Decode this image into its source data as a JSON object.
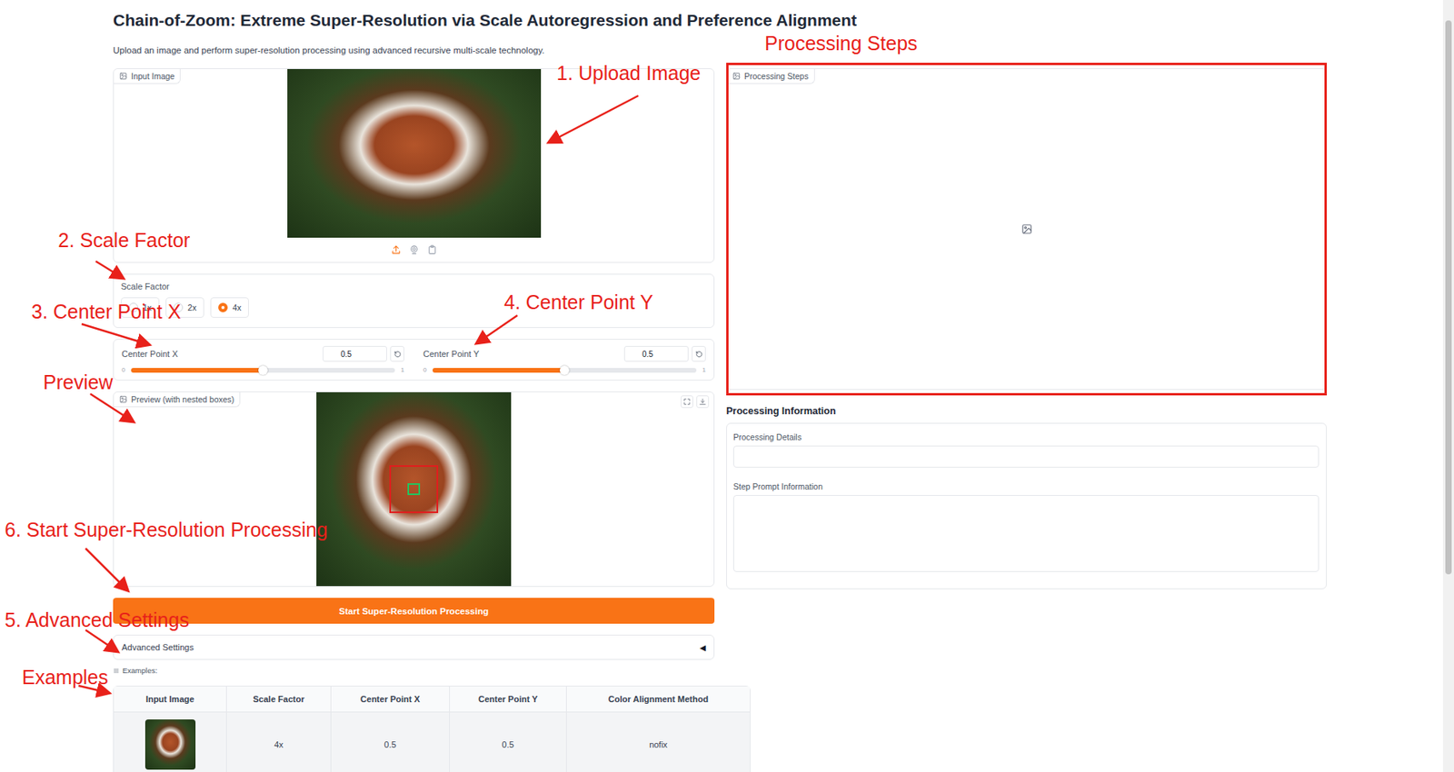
{
  "title": "Chain-of-Zoom: Extreme Super-Resolution via Scale Autoregression and Preference Alignment",
  "subtitle": "Upload an image and perform super-resolution processing using advanced recursive multi-scale technology.",
  "input_image": {
    "label": "Input Image"
  },
  "scale_factor": {
    "label": "Scale Factor",
    "options": [
      {
        "label": "1x",
        "selected": false
      },
      {
        "label": "2x",
        "selected": false
      },
      {
        "label": "4x",
        "selected": true
      }
    ]
  },
  "sliders": [
    {
      "label": "Center Point X",
      "value": "0.5",
      "min": "0",
      "max": "1",
      "level": 0.5
    },
    {
      "label": "Center Point Y",
      "value": "0.5",
      "min": "0",
      "max": "1",
      "level": 0.5
    }
  ],
  "preview": {
    "label": "Preview (with nested boxes)"
  },
  "start_button": "Start Super-Resolution Processing",
  "advanced": {
    "label": "Advanced Settings",
    "icon": "◀",
    "expanded": false
  },
  "examples": {
    "label": "Examples:",
    "columns": [
      "Input Image",
      "Scale Factor",
      "Center Point X",
      "Center Point Y",
      "Color Alignment Method"
    ],
    "rows": [
      [
        "4x",
        "0.5",
        "0.5",
        "nofix"
      ]
    ]
  },
  "processing_steps": {
    "label": "Processing Steps"
  },
  "processing_info": {
    "heading": "Processing Information",
    "fields": [
      {
        "label": "Processing Details",
        "value": ""
      },
      {
        "label": "Step Prompt Information",
        "value": ""
      }
    ]
  },
  "annotations": [
    {
      "text": "Processing Steps"
    },
    {
      "text": "1. Upload Image"
    },
    {
      "text": "2. Scale Factor"
    },
    {
      "text": "4. Center Point Y"
    },
    {
      "text": "3. Center Point X"
    },
    {
      "text": "Preview"
    },
    {
      "text": "6. Start Super-Resolution Processing"
    },
    {
      "text": "5. Advanced Settings"
    },
    {
      "text": "Examples"
    }
  ]
}
